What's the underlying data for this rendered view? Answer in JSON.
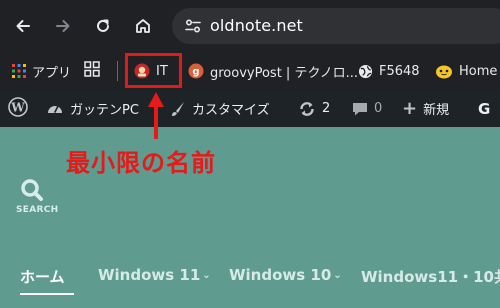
{
  "browser": {
    "url": "oldnote.net",
    "icons": [
      "back-arrow-icon",
      "forward-arrow-icon",
      "reload-icon",
      "home-icon",
      "site-settings-icon"
    ]
  },
  "bookmarks": {
    "apps_label": "アプリ",
    "items": [
      {
        "label": "IT",
        "icon": "bookmark-favicon-icon"
      },
      {
        "label": "groovyPost | テクノロ...",
        "icon": "groovypost-icon"
      },
      {
        "label": "F5648",
        "icon": "globe-icon"
      },
      {
        "label": "Home",
        "icon": "character-face-icon"
      }
    ]
  },
  "adminbar": {
    "site_name": "ガッテンPC",
    "customize_label": "カスタマイズ",
    "updates_count": "2",
    "comments_count": "0",
    "new_label": "新規",
    "extra_label": "G"
  },
  "annotation": {
    "text": "最小限の名前",
    "color": "#e51a1a"
  },
  "page": {
    "search_label": "SEARCH",
    "nav": [
      {
        "label": "ホーム",
        "active": true
      },
      {
        "label": "Windows 11",
        "dropdown": true
      },
      {
        "label": "Windows 10",
        "dropdown": true
      },
      {
        "label": "Windows11・10共"
      }
    ]
  },
  "colors": {
    "browser_bg": "#202124",
    "adminbar_bg": "#1d2327",
    "page_bg": "#5f9b8f",
    "highlight": "#e01a1a"
  }
}
